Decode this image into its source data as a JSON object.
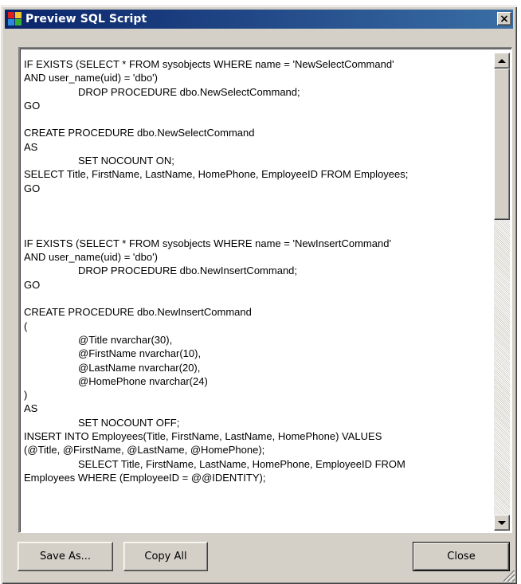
{
  "window": {
    "title": "Preview SQL Script",
    "close_glyph": "×"
  },
  "script": {
    "lines": [
      "IF EXISTS (SELECT * FROM sysobjects WHERE name = 'NewSelectCommand'",
      "AND user_name(uid) = 'dbo')",
      "\t\tDROP PROCEDURE dbo.NewSelectCommand;",
      "GO",
      "",
      "CREATE PROCEDURE dbo.NewSelectCommand",
      "AS",
      "\t\tSET NOCOUNT ON;",
      "SELECT Title, FirstName, LastName, HomePhone, EmployeeID FROM Employees;",
      "GO",
      "",
      "",
      "",
      "IF EXISTS (SELECT * FROM sysobjects WHERE name = 'NewInsertCommand'",
      "AND user_name(uid) = 'dbo')",
      "\t\tDROP PROCEDURE dbo.NewInsertCommand;",
      "GO",
      "",
      "CREATE PROCEDURE dbo.NewInsertCommand",
      "(",
      "\t\t@Title nvarchar(30),",
      "\t\t@FirstName nvarchar(10),",
      "\t\t@LastName nvarchar(20),",
      "\t\t@HomePhone nvarchar(24)",
      ")",
      "AS",
      "\t\tSET NOCOUNT OFF;",
      "INSERT INTO Employees(Title, FirstName, LastName, HomePhone) VALUES",
      "(@Title, @FirstName, @LastName, @HomePhone);",
      "\t\tSELECT Title, FirstName, LastName, HomePhone, EmployeeID FROM",
      "Employees WHERE (EmployeeID = @@IDENTITY);"
    ]
  },
  "buttons": {
    "save_as": "Save As...",
    "copy_all": "Copy All",
    "close": "Close"
  },
  "icons": {
    "app": "sql-script-icon",
    "close": "close-icon",
    "scroll_up": "scroll-up-arrow-icon",
    "scroll_down": "scroll-down-arrow-icon",
    "resize": "resize-grip-icon"
  },
  "colors": {
    "titlebar_start": "#0a246a",
    "titlebar_end": "#3a6ea5",
    "face": "#d4d0c8"
  }
}
